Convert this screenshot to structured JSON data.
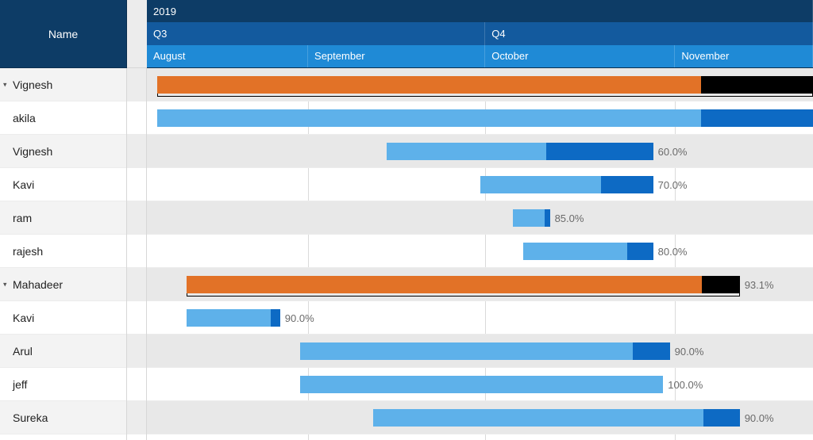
{
  "header": {
    "name_column_label": "Name",
    "year_label": "2019",
    "quarters": [
      {
        "label": "Q3",
        "width_pct": 50.8
      },
      {
        "label": "Q4",
        "width_pct": 49.2
      }
    ],
    "months": [
      {
        "label": "August",
        "start_pct": 0,
        "width_pct": 24.2
      },
      {
        "label": "September",
        "start_pct": 24.2,
        "width_pct": 26.6
      },
      {
        "label": "October",
        "start_pct": 50.8,
        "width_pct": 28.5
      },
      {
        "label": "November",
        "start_pct": 79.3,
        "width_pct": 20.7
      }
    ]
  },
  "colors": {
    "task_done": "#5eb1ea",
    "task_remaining": "#0d6ac4",
    "summary_done": "#e27227",
    "summary_remaining": "#000000",
    "header_dark": "#0d3c66",
    "header_mid": "#135a9e",
    "header_light": "#1f8ad6"
  },
  "rows": [
    {
      "name": "Vignesh",
      "summary": true,
      "expanded": true,
      "start_pct": 1.5,
      "width_pct": 98.5,
      "progress_pct": 83.0,
      "label": ""
    },
    {
      "name": "akila",
      "summary": false,
      "expanded": false,
      "start_pct": 1.5,
      "width_pct": 98.5,
      "progress_pct": 83.0,
      "label": ""
    },
    {
      "name": "Vignesh",
      "summary": false,
      "expanded": false,
      "start_pct": 36.0,
      "width_pct": 40.0,
      "progress_pct": 60.0,
      "label": "60.0%"
    },
    {
      "name": "Kavi",
      "summary": false,
      "expanded": false,
      "start_pct": 50.0,
      "width_pct": 26.0,
      "progress_pct": 70.0,
      "label": "70.0%"
    },
    {
      "name": "ram",
      "summary": false,
      "expanded": false,
      "start_pct": 55.0,
      "width_pct": 5.5,
      "progress_pct": 85.0,
      "label": "85.0%"
    },
    {
      "name": "rajesh",
      "summary": false,
      "expanded": false,
      "start_pct": 56.5,
      "width_pct": 19.5,
      "progress_pct": 80.0,
      "label": "80.0%"
    },
    {
      "name": "Mahadeer",
      "summary": true,
      "expanded": true,
      "start_pct": 6.0,
      "width_pct": 83.0,
      "progress_pct": 93.1,
      "label": "93.1%"
    },
    {
      "name": "Kavi",
      "summary": false,
      "expanded": false,
      "start_pct": 6.0,
      "width_pct": 14.0,
      "progress_pct": 90.0,
      "label": "90.0%"
    },
    {
      "name": "Arul",
      "summary": false,
      "expanded": false,
      "start_pct": 23.0,
      "width_pct": 55.5,
      "progress_pct": 90.0,
      "label": "90.0%"
    },
    {
      "name": "jeff",
      "summary": false,
      "expanded": false,
      "start_pct": 23.0,
      "width_pct": 54.5,
      "progress_pct": 100.0,
      "label": "100.0%"
    },
    {
      "name": "Sureka",
      "summary": false,
      "expanded": false,
      "start_pct": 34.0,
      "width_pct": 55.0,
      "progress_pct": 90.0,
      "label": "90.0%"
    }
  ],
  "chart_data": {
    "type": "bar",
    "title": "",
    "xlabel": "",
    "ylabel": "Name",
    "x_axis": {
      "year": 2019,
      "quarters": [
        "Q3",
        "Q4"
      ],
      "months": [
        "August",
        "September",
        "October",
        "November"
      ]
    },
    "series": [
      {
        "name": "Vignesh",
        "kind": "summary",
        "start_month": "August",
        "end_month": "November",
        "percent_complete": 83.0
      },
      {
        "name": "akila",
        "kind": "task",
        "start_month": "August",
        "end_month": "November",
        "percent_complete": 83.0
      },
      {
        "name": "Vignesh",
        "kind": "task",
        "start_month": "September",
        "end_month": "October",
        "percent_complete": 60.0
      },
      {
        "name": "Kavi",
        "kind": "task",
        "start_month": "October",
        "end_month": "October",
        "percent_complete": 70.0
      },
      {
        "name": "ram",
        "kind": "task",
        "start_month": "October",
        "end_month": "October",
        "percent_complete": 85.0
      },
      {
        "name": "rajesh",
        "kind": "task",
        "start_month": "October",
        "end_month": "October",
        "percent_complete": 80.0
      },
      {
        "name": "Mahadeer",
        "kind": "summary",
        "start_month": "August",
        "end_month": "November",
        "percent_complete": 93.1
      },
      {
        "name": "Kavi",
        "kind": "task",
        "start_month": "August",
        "end_month": "August",
        "percent_complete": 90.0
      },
      {
        "name": "Arul",
        "kind": "task",
        "start_month": "August",
        "end_month": "October",
        "percent_complete": 90.0
      },
      {
        "name": "jeff",
        "kind": "task",
        "start_month": "August",
        "end_month": "October",
        "percent_complete": 100.0
      },
      {
        "name": "Sureka",
        "kind": "task",
        "start_month": "September",
        "end_month": "November",
        "percent_complete": 90.0
      }
    ]
  }
}
